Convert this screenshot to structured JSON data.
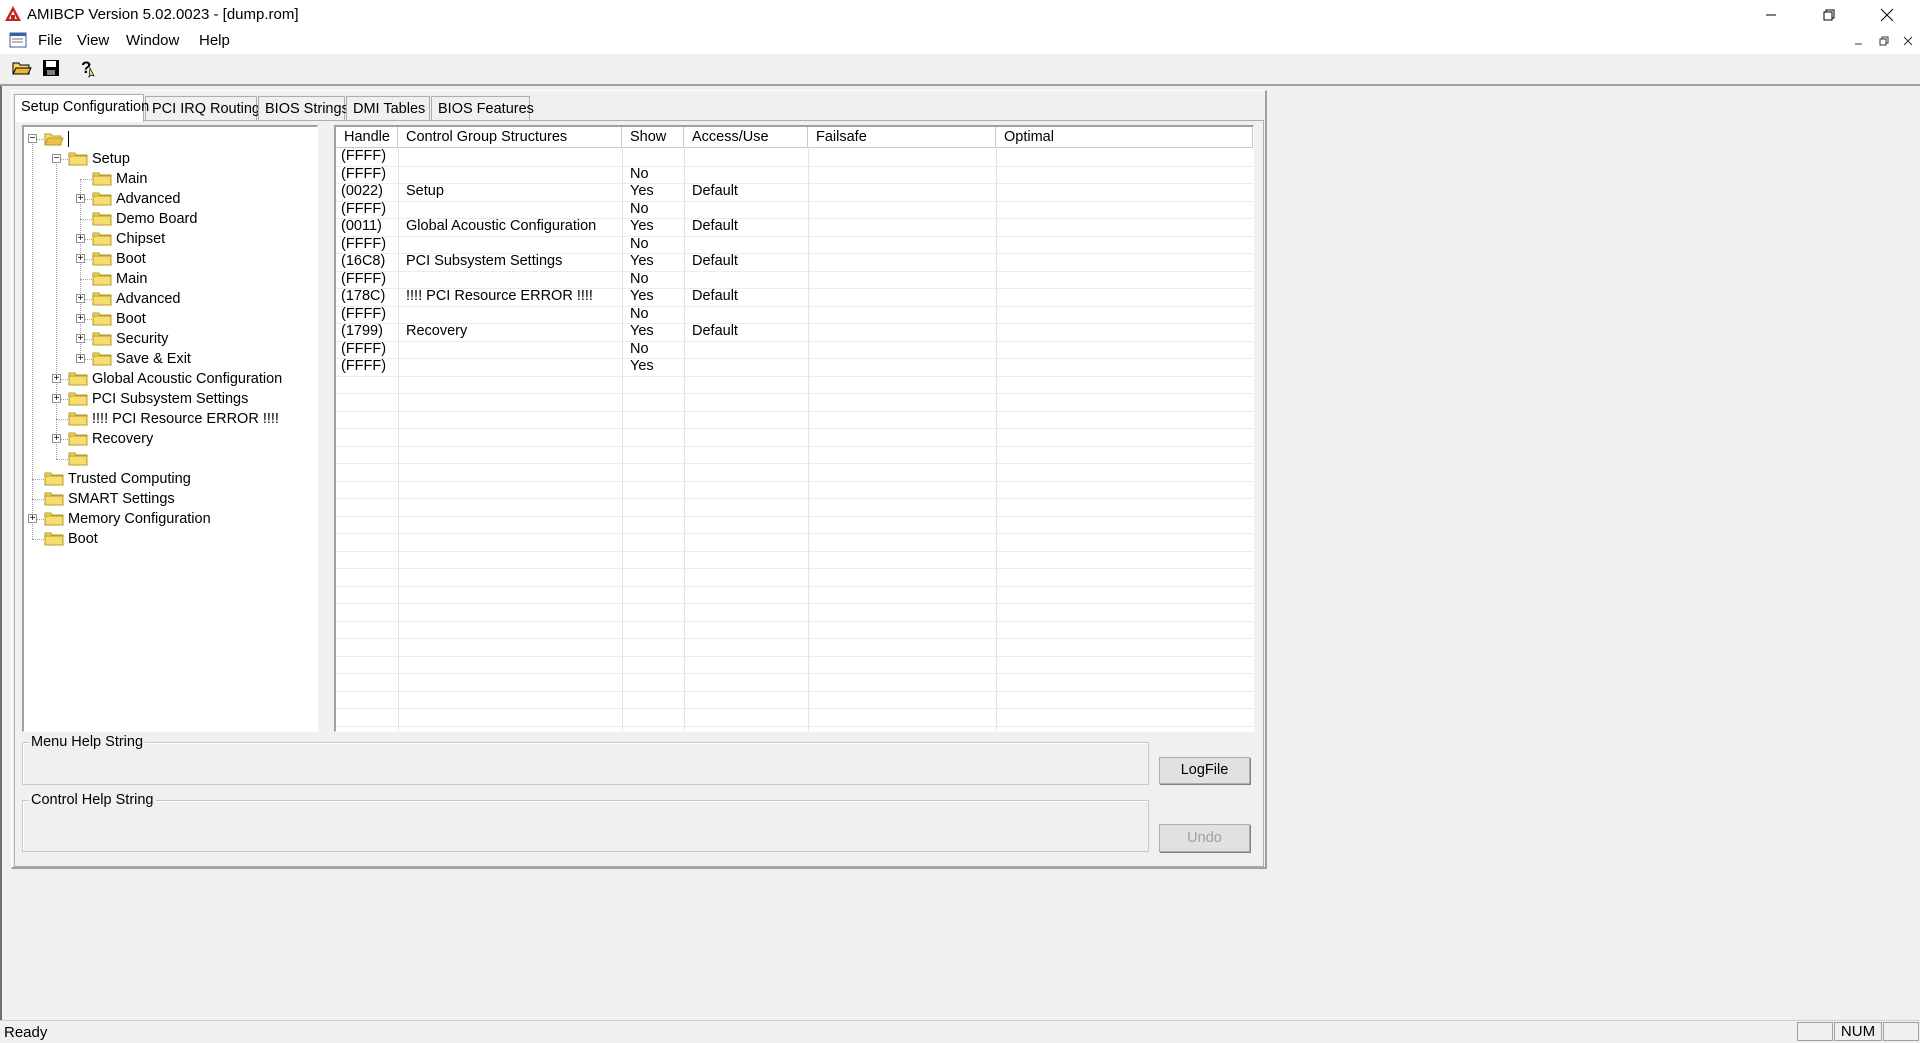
{
  "window": {
    "title": "AMIBCP Version 5.02.0023 - [dump.rom]"
  },
  "menu": {
    "items": [
      "File",
      "View",
      "Window",
      "Help"
    ]
  },
  "toolbar": {
    "icons": [
      "open-folder-icon",
      "save-icon",
      "help-icon"
    ]
  },
  "tabs": [
    {
      "label": "Setup Configuration",
      "active": true
    },
    {
      "label": "PCI IRQ Routing",
      "active": false
    },
    {
      "label": "BIOS Strings",
      "active": false
    },
    {
      "label": "DMI Tables",
      "active": false
    },
    {
      "label": "BIOS Features",
      "active": false
    }
  ],
  "tree": {
    "nodes": [
      {
        "label": "",
        "level": 0,
        "expander": "minus",
        "selected": true,
        "open": true
      },
      {
        "label": "Setup",
        "level": 1,
        "expander": "minus"
      },
      {
        "label": "Main",
        "level": 2,
        "expander": "none"
      },
      {
        "label": "Advanced",
        "level": 2,
        "expander": "plus"
      },
      {
        "label": "Demo Board",
        "level": 2,
        "expander": "none"
      },
      {
        "label": "Chipset",
        "level": 2,
        "expander": "plus"
      },
      {
        "label": "Boot",
        "level": 2,
        "expander": "plus"
      },
      {
        "label": "Main",
        "level": 2,
        "expander": "none"
      },
      {
        "label": "Advanced",
        "level": 2,
        "expander": "plus"
      },
      {
        "label": "Boot",
        "level": 2,
        "expander": "plus"
      },
      {
        "label": "Security",
        "level": 2,
        "expander": "plus"
      },
      {
        "label": "Save & Exit",
        "level": 2,
        "expander": "plus"
      },
      {
        "label": "Global Acoustic Configuration",
        "level": 1,
        "expander": "plus"
      },
      {
        "label": "PCI Subsystem Settings",
        "level": 1,
        "expander": "plus"
      },
      {
        "label": "!!!! PCI Resource ERROR !!!!",
        "level": 1,
        "expander": "none"
      },
      {
        "label": "Recovery",
        "level": 1,
        "expander": "plus"
      },
      {
        "label": "",
        "level": 1,
        "expander": "none"
      },
      {
        "label": "Trusted Computing",
        "level": 0,
        "expander": "none"
      },
      {
        "label": "SMART Settings",
        "level": 0,
        "expander": "none"
      },
      {
        "label": "Memory Configuration",
        "level": 0,
        "expander": "plus"
      },
      {
        "label": "Boot",
        "level": 0,
        "expander": "none"
      }
    ]
  },
  "grid": {
    "columns": [
      "Handle",
      "Control Group Structures",
      "Show",
      "Access/Use",
      "Failsafe",
      "Optimal"
    ],
    "rows": [
      [
        "(FFFF)",
        "",
        "",
        "",
        "",
        ""
      ],
      [
        "(FFFF)",
        "",
        "No",
        "",
        "",
        ""
      ],
      [
        "(0022)",
        "Setup",
        "Yes",
        "Default",
        "",
        ""
      ],
      [
        "(FFFF)",
        "",
        "No",
        "",
        "",
        ""
      ],
      [
        "(0011)",
        "Global Acoustic Configuration",
        "Yes",
        "Default",
        "",
        ""
      ],
      [
        "(FFFF)",
        "",
        "No",
        "",
        "",
        ""
      ],
      [
        "(16C8)",
        "PCI Subsystem Settings",
        "Yes",
        "Default",
        "",
        ""
      ],
      [
        "(FFFF)",
        "",
        "No",
        "",
        "",
        ""
      ],
      [
        "(178C)",
        "!!!! PCI Resource ERROR !!!!",
        "Yes",
        "Default",
        "",
        ""
      ],
      [
        "(FFFF)",
        "",
        "No",
        "",
        "",
        ""
      ],
      [
        "(1799)",
        "Recovery",
        "Yes",
        "Default",
        "",
        ""
      ],
      [
        "(FFFF)",
        "",
        "No",
        "",
        "",
        ""
      ],
      [
        "(FFFF)",
        "",
        "Yes",
        "",
        "",
        ""
      ]
    ]
  },
  "help": {
    "menu_help_label": "Menu Help String",
    "control_help_label": "Control Help String"
  },
  "buttons": {
    "logfile": "LogFile",
    "undo": "Undo"
  },
  "status": {
    "text": "Ready",
    "num": "NUM"
  }
}
